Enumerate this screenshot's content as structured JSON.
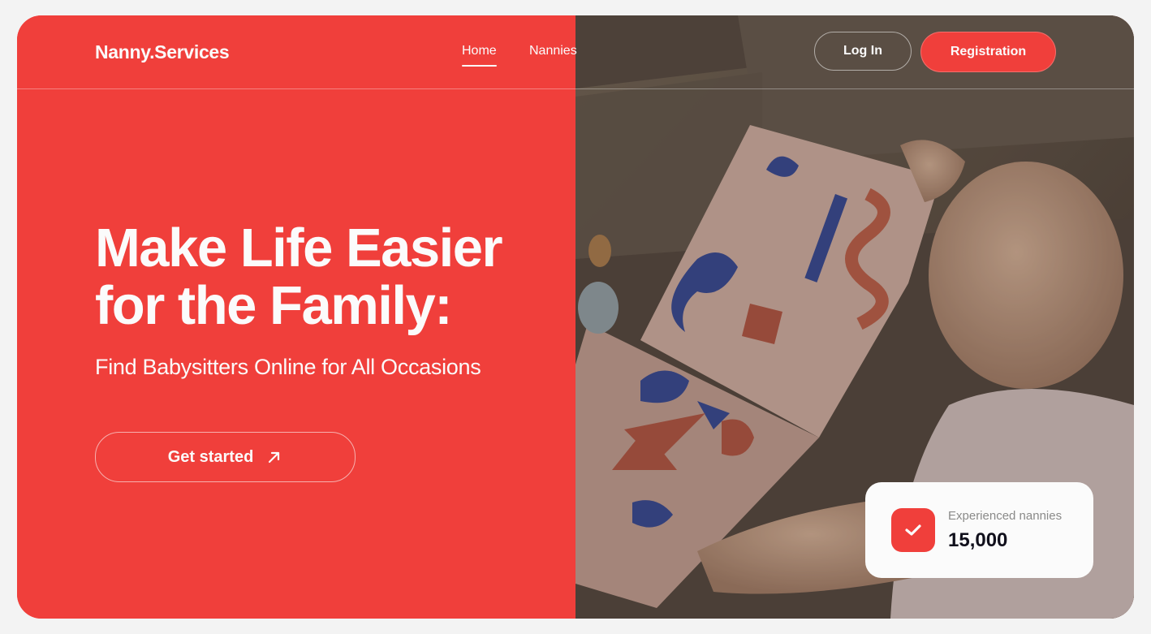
{
  "header": {
    "logo": "Nanny.Services",
    "nav": [
      {
        "label": "Home",
        "active": true
      },
      {
        "label": "Nannies",
        "active": false
      }
    ],
    "login_label": "Log In",
    "register_label": "Registration"
  },
  "hero": {
    "title": "Make Life Easier for the Family:",
    "subtitle": "Find Babysitters Online for All Occasions",
    "cta_label": "Get started",
    "cta_icon": "arrow-up-right-icon"
  },
  "stat": {
    "label": "Experienced nannies",
    "value": "15,000",
    "icon": "check-icon"
  },
  "colors": {
    "accent": "#f03f3b",
    "text_light": "#fbfbfb",
    "text_dark": "#11101c",
    "text_muted": "#8a8a89"
  }
}
